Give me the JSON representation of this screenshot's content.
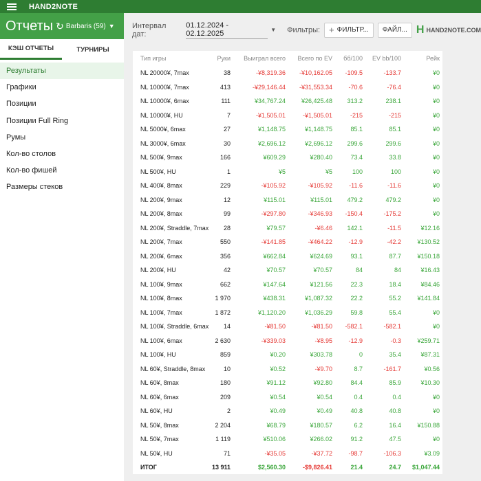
{
  "app": {
    "title": "HAND2NOTE"
  },
  "header": {
    "title": "Отчеты",
    "player": "Barbaris (59)"
  },
  "toolbar": {
    "interval_label": "Интервал дат:",
    "date_range": "01.12.2024 - 02.12.2025",
    "filters_label": "Фильтры:",
    "filter_button": "ФИЛЬТР...",
    "file_button": "ФАЙЛ...",
    "logo_text": "HAND2NOTE.COM"
  },
  "sidebar": {
    "tabs": [
      {
        "label": "КЭШ ОТЧЕТЫ"
      },
      {
        "label": "ТУРНИРЫ"
      }
    ],
    "items": [
      {
        "label": "Результаты"
      },
      {
        "label": "Графики"
      },
      {
        "label": "Позиции"
      },
      {
        "label": "Позиции Full Ring"
      },
      {
        "label": "Румы"
      },
      {
        "label": "Кол-во столов"
      },
      {
        "label": "Кол-во фишей"
      },
      {
        "label": "Размеры стеков"
      }
    ]
  },
  "table": {
    "columns": [
      "Тип игры",
      "Руки",
      "Выиграл всего",
      "Всего по EV",
      "бб/100",
      "EV bb/100",
      "Рейк"
    ],
    "rows": [
      [
        "NL 20000¥, 7max",
        "38",
        "-¥8,319.36",
        "-¥10,162.05",
        "-109.5",
        "-133.7",
        "¥0"
      ],
      [
        "NL 10000¥, 7max",
        "413",
        "-¥29,146.44",
        "-¥31,553.34",
        "-70.6",
        "-76.4",
        "¥0"
      ],
      [
        "NL 10000¥, 6max",
        "111",
        "¥34,767.24",
        "¥26,425.48",
        "313.2",
        "238.1",
        "¥0"
      ],
      [
        "NL 10000¥, HU",
        "7",
        "-¥1,505.01",
        "-¥1,505.01",
        "-215",
        "-215",
        "¥0"
      ],
      [
        "NL 5000¥, 6max",
        "27",
        "¥1,148.75",
        "¥1,148.75",
        "85.1",
        "85.1",
        "¥0"
      ],
      [
        "NL 3000¥, 6max",
        "30",
        "¥2,696.12",
        "¥2,696.12",
        "299.6",
        "299.6",
        "¥0"
      ],
      [
        "NL 500¥, 9max",
        "166",
        "¥609.29",
        "¥280.40",
        "73.4",
        "33.8",
        "¥0"
      ],
      [
        "NL 500¥, HU",
        "1",
        "¥5",
        "¥5",
        "100",
        "100",
        "¥0"
      ],
      [
        "NL 400¥, 8max",
        "229",
        "-¥105.92",
        "-¥105.92",
        "-11.6",
        "-11.6",
        "¥0"
      ],
      [
        "NL 200¥, 9max",
        "12",
        "¥115.01",
        "¥115.01",
        "479.2",
        "479.2",
        "¥0"
      ],
      [
        "NL 200¥, 8max",
        "99",
        "-¥297.80",
        "-¥346.93",
        "-150.4",
        "-175.2",
        "¥0"
      ],
      [
        "NL 200¥, Straddle, 7max",
        "28",
        "¥79.57",
        "-¥6.46",
        "142.1",
        "-11.5",
        "¥12.16"
      ],
      [
        "NL 200¥, 7max",
        "550",
        "-¥141.85",
        "-¥464.22",
        "-12.9",
        "-42.2",
        "¥130.52"
      ],
      [
        "NL 200¥, 6max",
        "356",
        "¥662.84",
        "¥624.69",
        "93.1",
        "87.7",
        "¥150.18"
      ],
      [
        "NL 200¥, HU",
        "42",
        "¥70.57",
        "¥70.57",
        "84",
        "84",
        "¥16.43"
      ],
      [
        "NL 100¥, 9max",
        "662",
        "¥147.64",
        "¥121.56",
        "22.3",
        "18.4",
        "¥84.46"
      ],
      [
        "NL 100¥, 8max",
        "1 970",
        "¥438.31",
        "¥1,087.32",
        "22.2",
        "55.2",
        "¥141.84"
      ],
      [
        "NL 100¥, 7max",
        "1 872",
        "¥1,120.20",
        "¥1,036.29",
        "59.8",
        "55.4",
        "¥0"
      ],
      [
        "NL 100¥, Straddle, 6max",
        "14",
        "-¥81.50",
        "-¥81.50",
        "-582.1",
        "-582.1",
        "¥0"
      ],
      [
        "NL 100¥, 6max",
        "2 630",
        "-¥339.03",
        "-¥8.95",
        "-12.9",
        "-0.3",
        "¥259.71"
      ],
      [
        "NL 100¥, HU",
        "859",
        "¥0.20",
        "¥303.78",
        "0",
        "35.4",
        "¥87.31"
      ],
      [
        "NL 60¥, Straddle, 8max",
        "10",
        "¥0.52",
        "-¥9.70",
        "8.7",
        "-161.7",
        "¥0.56"
      ],
      [
        "NL 60¥, 8max",
        "180",
        "¥91.12",
        "¥92.80",
        "84.4",
        "85.9",
        "¥10.30"
      ],
      [
        "NL 60¥, 6max",
        "209",
        "¥0.54",
        "¥0.54",
        "0.4",
        "0.4",
        "¥0"
      ],
      [
        "NL 60¥, HU",
        "2",
        "¥0.49",
        "¥0.49",
        "40.8",
        "40.8",
        "¥0"
      ],
      [
        "NL 50¥, 8max",
        "2 204",
        "¥68.79",
        "¥180.57",
        "6.2",
        "16.4",
        "¥150.88"
      ],
      [
        "NL 50¥, 7max",
        "1 119",
        "¥510.06",
        "¥266.02",
        "91.2",
        "47.5",
        "¥0"
      ],
      [
        "NL 50¥, HU",
        "71",
        "-¥35.05",
        "-¥37.72",
        "-98.7",
        "-106.3",
        "¥3.09"
      ]
    ],
    "total": [
      "ИТОГ",
      "13 911",
      "$2,560.30",
      "-$9,826.41",
      "21.4",
      "24.7",
      "$1,047.44"
    ]
  }
}
